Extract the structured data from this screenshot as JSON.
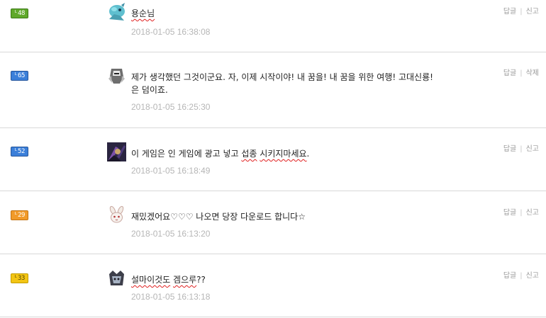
{
  "comments": [
    {
      "level": "48",
      "level_color": "#5fa82a",
      "avatar": "blue-dragon-avatar",
      "text": "용순님",
      "timestamp": "2018-01-05  16:38:08",
      "action_reply": "답글",
      "action_report": "신고"
    },
    {
      "level": "65",
      "level_color": "#3b7fd9",
      "avatar": "armored-knight-avatar",
      "text": "제가 생각했던 그것이군요. 자, 이제 시작이야! 내 꿈을! 내 꿈을 위한 여행! 고대신룡!",
      "text_line2": "은 덤이죠.",
      "timestamp": "2018-01-05  16:25:30",
      "action_reply": "답글",
      "action_report": "삭제"
    },
    {
      "level": "52",
      "level_color": "#3b7fd9",
      "avatar": "dark-warrior-avatar",
      "text_prefix": "이 게임은 인 게임에 광고 넣고 ",
      "text_mark1": "섭종",
      "text_space": " ",
      "text_mark2": "시키지마세요",
      "text_suffix": ".",
      "timestamp": "2018-01-05  16:18:49",
      "action_reply": "답글",
      "action_report": "신고"
    },
    {
      "level": "29",
      "level_color": "#f19a2a",
      "avatar": "white-rabbit-avatar",
      "text": "재밌겠어요♡♡♡ 나오면 당장 다운로드 합니다☆",
      "timestamp": "2018-01-05  16:13:20",
      "action_reply": "답글",
      "action_report": "신고"
    },
    {
      "level": "33",
      "level_color": "#f3c514",
      "avatar": "dark-crown-avatar",
      "text_mark1": "설마이것도",
      "text_space": " ",
      "text_mark2": "겜으루",
      "text_suffix": "??",
      "timestamp": "2018-01-05  16:13:18",
      "action_reply": "답글",
      "action_report": "신고"
    }
  ]
}
